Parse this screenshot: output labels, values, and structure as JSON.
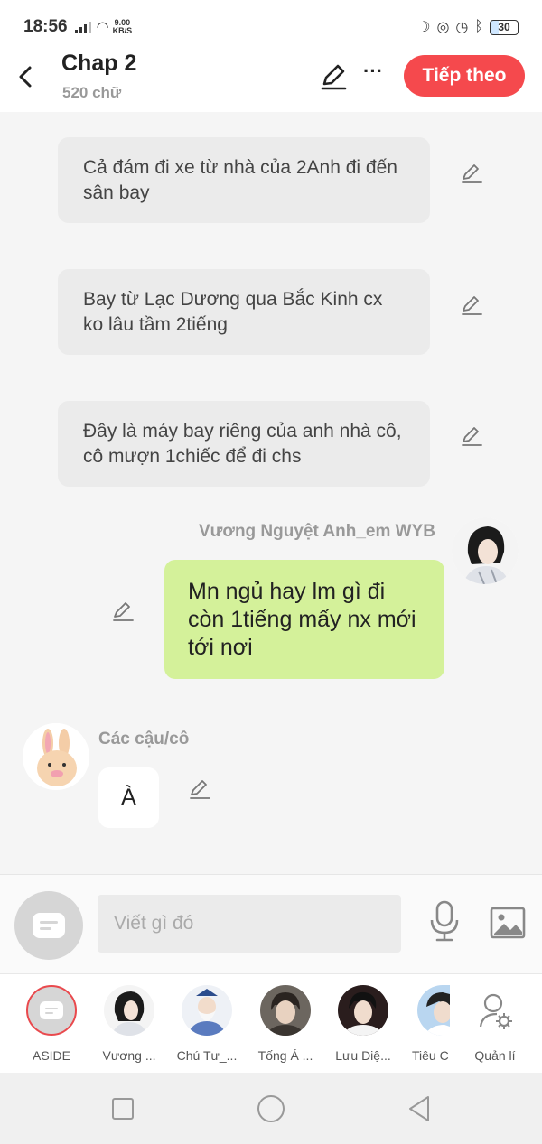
{
  "status_bar": {
    "time": "18:56",
    "network_speed_value": "9.00",
    "network_speed_unit": "KB/S",
    "battery": "30"
  },
  "header": {
    "title": "Chap 2",
    "word_count": "520 chữ",
    "next_button": "Tiếp theo"
  },
  "narrations": [
    {
      "text": "Cả đám đi xe từ nhà của 2Anh đi đến sân bay"
    },
    {
      "text": "Bay từ Lạc Dương qua Bắc Kinh cx ko lâu tầm 2tiếng"
    },
    {
      "text": "Đây là máy bay riêng của anh nhà cô, cô mượn 1chiếc để đi chs"
    }
  ],
  "messages": [
    {
      "speaker": "Vương Nguyệt Anh_em WYB",
      "text": "Mn ngủ hay lm gì đi còn 1tiếng mấy nx mới tới nơi",
      "side": "right"
    },
    {
      "speaker": "Các cậu/cô",
      "text": "À",
      "side": "left"
    }
  ],
  "composer": {
    "placeholder": "Viết gì đó"
  },
  "characters": [
    {
      "name": "ASIDE"
    },
    {
      "name": "Vương ..."
    },
    {
      "name": "Chú Tư_..."
    },
    {
      "name": "Tống Á ..."
    },
    {
      "name": "Lưu Diệ..."
    },
    {
      "name": "Tiêu C"
    },
    {
      "name": "Quản lí"
    }
  ],
  "colors": {
    "accent": "#f5494d",
    "bubble_self": "#d4f19a",
    "narration_bg": "#ebebeb",
    "background": "#f5f5f5"
  }
}
